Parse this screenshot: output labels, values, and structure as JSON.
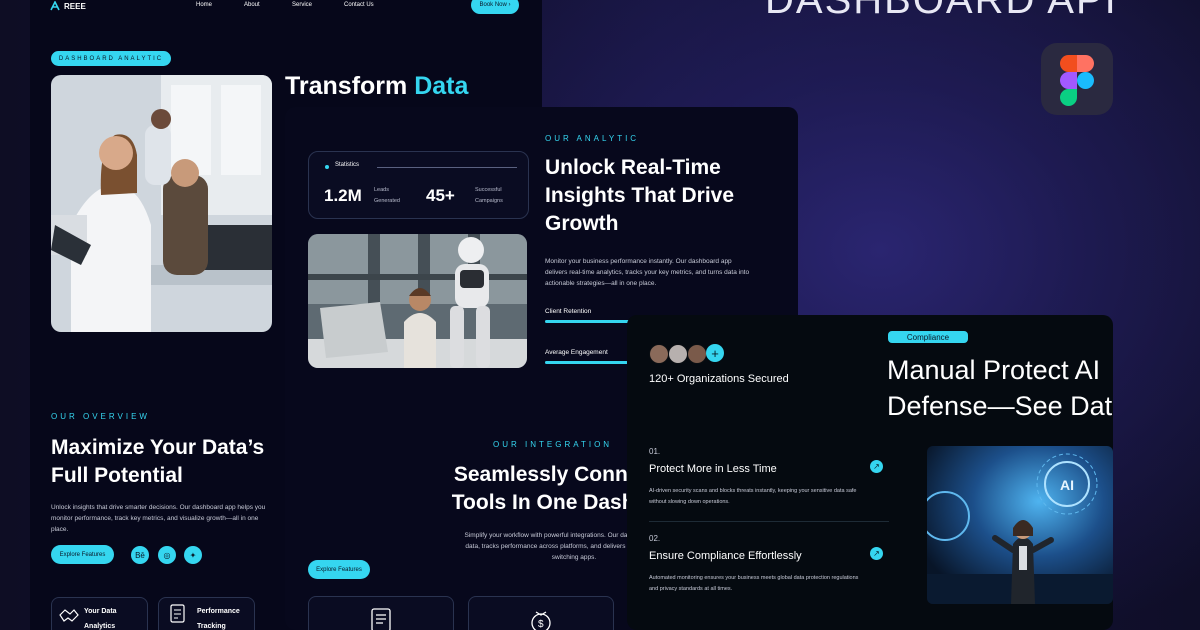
{
  "cover": {
    "title": "DASHBOARD API",
    "tool_icon": "figma-icon",
    "colors": {
      "accent": "#35d6f0",
      "background": "#0d0c22",
      "panel": "#07081c"
    }
  },
  "landing": {
    "logo": "REEE",
    "nav": [
      "Home",
      "About",
      "Service",
      "Contact Us"
    ],
    "book_button": "Book Now",
    "badge": "DASHBOARD ANALYTIC",
    "hero_heading_white": "Transform ",
    "hero_heading_accent": "Data",
    "overview": {
      "eyebrow": "OUR OVERVIEW",
      "heading_line1": "Maximize Your Data’s",
      "heading_line2": "Full Potential",
      "body": "Unlock insights that drive smarter decisions. Our dashboard app helps you monitor performance, track key metrics, and visualize growth—all in one place.",
      "cta": "Explore Features",
      "social": [
        "Bē",
        "◎",
        "✦"
      ]
    },
    "feature_cards": [
      {
        "line1": "Your Data",
        "line2": "Analytics"
      },
      {
        "line1": "Performance",
        "line2": "Tracking"
      }
    ]
  },
  "analytic": {
    "stats_label": "Statistics",
    "stats": [
      {
        "value": "1.2M",
        "label_line1": "Leads",
        "label_line2": "Generated"
      },
      {
        "value": "45+",
        "label_line1": "Successful",
        "label_line2": "Campaigns"
      }
    ],
    "eyebrow": "OUR ANALYTIC",
    "heading_line1": "Unlock Real-Time",
    "heading_line2": "Insights That Drive",
    "heading_line3": "Growth",
    "body": "Monitor your business performance instantly. Our dashboard app delivers real-time analytics, tracks your key metrics, and turns data into actionable strategies—all in one place.",
    "metrics": [
      {
        "label": "Client Retention",
        "progress": 0.55
      },
      {
        "label": "Average Engagement",
        "progress": 0.72
      }
    ],
    "integration": {
      "eyebrow": "OUR INTEGRATION",
      "heading_line1": "Seamlessly Connect",
      "heading_line2": "Tools In One Dashbo",
      "body_line1": "Simplify your workflow with powerful integrations. Our dashboard app centra",
      "body_line2": "data, tracks performance across platforms, and delivers insights without the",
      "body_line3": "switching apps.",
      "cta": "Explore Features"
    }
  },
  "compliance": {
    "orgs_text": "120+ Organizations Secured",
    "badge": "Compliance",
    "heading_line1": "Manual Protect AI",
    "heading_line2": "Defense—See Data",
    "items": [
      {
        "number": "01.",
        "title": "Protect More in Less Time",
        "body_line1": "AI-driven security scans and blocks threats instantly, keeping your sensitive data safe",
        "body_line2": "without slowing down operations."
      },
      {
        "number": "02.",
        "title": "Ensure Compliance Effortlessly",
        "body_line1": "Automated monitoring ensures your business meets global data protection regulations",
        "body_line2": "and privacy standards at all times."
      }
    ],
    "ai_label": "AI"
  }
}
